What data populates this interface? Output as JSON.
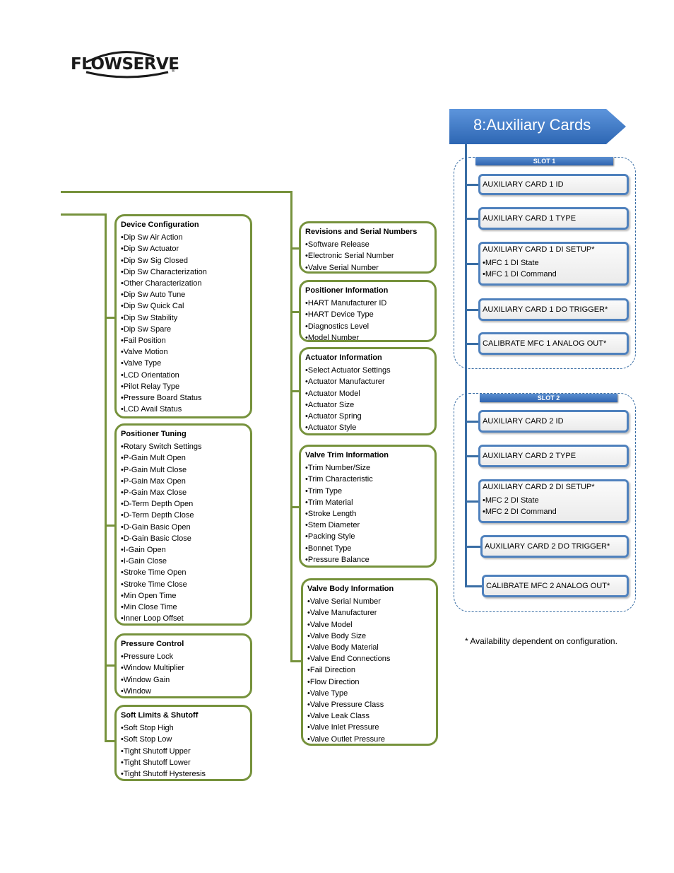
{
  "logo": {
    "text": "FLOWSERVE",
    "registered": "®"
  },
  "header": {
    "title": "8:Auxiliary Cards",
    "color": "#3e7bc9"
  },
  "slots": [
    {
      "label": "SLOT   1",
      "cards": [
        {
          "title": "AUXILIARY CARD 1 ID",
          "items": []
        },
        {
          "title": "AUXILIARY CARD 1 TYPE",
          "items": []
        },
        {
          "title": "AUXILIARY CARD 1 DI SETUP*",
          "items": [
            "MFC 1 DI State",
            "MFC 1 DI Command"
          ]
        },
        {
          "title": "AUXILIARY CARD 1 DO TRIGGER*",
          "items": []
        },
        {
          "title": "CALIBRATE MFC 1 ANALOG OUT*",
          "items": []
        }
      ]
    },
    {
      "label": "SLOT   2",
      "cards": [
        {
          "title": "AUXILIARY CARD 2 ID",
          "items": []
        },
        {
          "title": "AUXILIARY CARD 2 TYPE",
          "items": []
        },
        {
          "title": "AUXILIARY CARD 2 DI SETUP*",
          "items": [
            "MFC 2 DI State",
            "MFC 2 DI Command"
          ]
        },
        {
          "title": "AUXILIARY CARD 2 DO TRIGGER*",
          "items": []
        },
        {
          "title": "CALIBRATE MFC 2 ANALOG OUT*",
          "items": []
        }
      ]
    }
  ],
  "footnote": "* Availability dependent on configuration.",
  "left_groups": [
    {
      "title": "Device Configuration",
      "items": [
        "Dip Sw Air Action",
        "Dip Sw Actuator",
        "Dip Sw Sig Closed",
        "Dip Sw Characterization",
        "Other Characterization",
        "Dip Sw Auto Tune",
        "Dip Sw Quick Cal",
        "Dip Sw Stability",
        "Dip Sw Spare",
        "Fail Position",
        "Valve Motion",
        "Valve Type",
        "LCD Orientation",
        "Pilot Relay Type",
        "Pressure Board Status",
        "LCD Avail Status"
      ]
    },
    {
      "title": "Positioner Tuning",
      "items": [
        "Rotary Switch Settings",
        "P-Gain Mult Open",
        "P-Gain Mult Close",
        "P-Gain Max Open",
        "P-Gain Max Close",
        "D-Term Depth Open",
        "D-Term Depth Close",
        "D-Gain Basic Open",
        "D-Gain Basic Close",
        "I-Gain Open",
        "I-Gain Close",
        "Stroke Time Open",
        "Stroke Time Close",
        "Min Open Time",
        "Min Close Time",
        "Inner Loop Offset"
      ]
    },
    {
      "title": "Pressure Control",
      "items": [
        "Pressure Lock",
        "Window Multiplier",
        "Window Gain",
        "Window"
      ]
    },
    {
      "title": "Soft Limits & Shutoff",
      "items": [
        "Soft Stop High",
        "Soft Stop Low",
        "Tight Shutoff Upper",
        "Tight Shutoff Lower",
        "Tight Shutoff Hysteresis"
      ]
    }
  ],
  "middle_groups": [
    {
      "title": "Revisions and Serial Numbers",
      "items": [
        "Software Release",
        "Electronic Serial Number",
        "Valve Serial Number"
      ]
    },
    {
      "title": "Positioner Information",
      "items": [
        "HART Manufacturer ID",
        "HART Device Type",
        "Diagnostics Level",
        "Model Number"
      ]
    },
    {
      "title": "Actuator Information",
      "items": [
        "Select Actuator Settings",
        "Actuator Manufacturer",
        "Actuator Model",
        "Actuator Size",
        "Actuator Spring",
        "Actuator Style"
      ]
    },
    {
      "title": "Valve Trim Information",
      "items": [
        "Trim Number/Size",
        "Trim Characteristic",
        "Trim Type",
        "Trim Material",
        "Stroke Length",
        "Stem Diameter",
        "Packing Style",
        "Bonnet Type",
        "Pressure Balance"
      ]
    },
    {
      "title": "Valve Body Information",
      "items": [
        "Valve Serial Number",
        "Valve Manufacturer",
        "Valve Model",
        "Valve Body Size",
        "Valve Body Material",
        "Valve End Connections",
        "Fail Direction",
        "Flow Direction",
        "Valve Type",
        "Valve Pressure Class",
        "Valve Leak Class",
        "Valve Inlet Pressure",
        "Valve Outlet Pressure"
      ]
    }
  ]
}
